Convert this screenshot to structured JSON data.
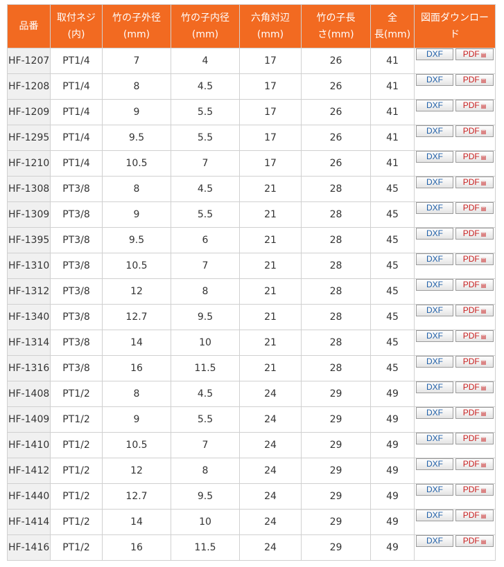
{
  "table": {
    "headers": [
      [
        "品番"
      ],
      [
        "取付ネジ",
        "(内)"
      ],
      [
        "竹の子外径",
        "(mm)"
      ],
      [
        "竹の子内径",
        "(mm)"
      ],
      [
        "六角対辺",
        "(mm)"
      ],
      [
        "竹の子長",
        "さ(mm)"
      ],
      [
        "全",
        "長(mm)"
      ],
      [
        "図面ダウンロー",
        "ド"
      ]
    ],
    "dxf_label": "DXF",
    "pdf_label": "PDF",
    "pdf_icon": "pdf-file-icon",
    "rows": [
      [
        "HF-1207",
        "PT1/4",
        "7",
        "4",
        "17",
        "26",
        "41"
      ],
      [
        "HF-1208",
        "PT1/4",
        "8",
        "4.5",
        "17",
        "26",
        "41"
      ],
      [
        "HF-1209",
        "PT1/4",
        "9",
        "5.5",
        "17",
        "26",
        "41"
      ],
      [
        "HF-1295",
        "PT1/4",
        "9.5",
        "5.5",
        "17",
        "26",
        "41"
      ],
      [
        "HF-1210",
        "PT1/4",
        "10.5",
        "7",
        "17",
        "26",
        "41"
      ],
      [
        "HF-1308",
        "PT3/8",
        "8",
        "4.5",
        "21",
        "28",
        "45"
      ],
      [
        "HF-1309",
        "PT3/8",
        "9",
        "5.5",
        "21",
        "28",
        "45"
      ],
      [
        "HF-1395",
        "PT3/8",
        "9.5",
        "6",
        "21",
        "28",
        "45"
      ],
      [
        "HF-1310",
        "PT3/8",
        "10.5",
        "7",
        "21",
        "28",
        "45"
      ],
      [
        "HF-1312",
        "PT3/8",
        "12",
        "8",
        "21",
        "28",
        "45"
      ],
      [
        "HF-1340",
        "PT3/8",
        "12.7",
        "9.5",
        "21",
        "28",
        "45"
      ],
      [
        "HF-1314",
        "PT3/8",
        "14",
        "10",
        "21",
        "28",
        "45"
      ],
      [
        "HF-1316",
        "PT3/8",
        "16",
        "11.5",
        "21",
        "28",
        "45"
      ],
      [
        "HF-1408",
        "PT1/2",
        "8",
        "4.5",
        "24",
        "29",
        "49"
      ],
      [
        "HF-1409",
        "PT1/2",
        "9",
        "5.5",
        "24",
        "29",
        "49"
      ],
      [
        "HF-1410",
        "PT1/2",
        "10.5",
        "7",
        "24",
        "29",
        "49"
      ],
      [
        "HF-1412",
        "PT1/2",
        "12",
        "8",
        "24",
        "29",
        "49"
      ],
      [
        "HF-1440",
        "PT1/2",
        "12.7",
        "9.5",
        "24",
        "29",
        "49"
      ],
      [
        "HF-1414",
        "PT1/2",
        "14",
        "10",
        "24",
        "29",
        "49"
      ],
      [
        "HF-1416",
        "PT1/2",
        "16",
        "11.5",
        "24",
        "29",
        "49"
      ]
    ]
  },
  "colors": {
    "header_bg": "#f26a21",
    "header_text": "#ffffff",
    "part_no_bg": "#f0f0f0",
    "border": "#d0d0d0",
    "dxf_text": "#1f5fa8",
    "pdf_text": "#c81e1e"
  }
}
